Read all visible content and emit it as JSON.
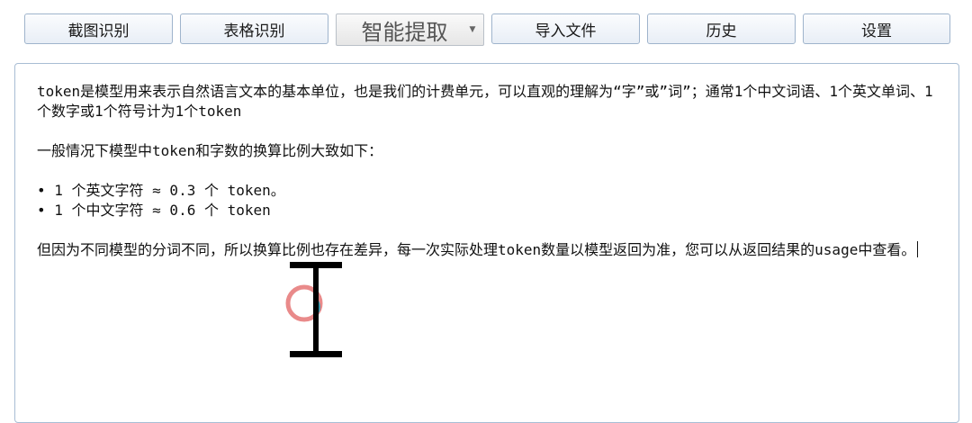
{
  "toolbar": {
    "screenshot_ocr": "截图识别",
    "table_ocr": "表格识别",
    "smart_extract": "智能提取",
    "import_file": "导入文件",
    "history": "历史",
    "settings": "设置"
  },
  "editor": {
    "para1": "token是模型用来表示自然语言文本的基本单位，也是我们的计费单元，可以直观的理解为“字”或”词”；通常1个中文词语、1个英文单词、1个数字或1个符号计为1个token",
    "para2": "一般情况下模型中token和字数的换算比例大致如下：",
    "bullets": [
      "• 1 个英文字符 ≈ 0.3 个 token。",
      "• 1 个中文字符 ≈ 0.6 个 token"
    ],
    "para3": "但因为不同模型的分词不同，所以换算比例也存在差异，每一次实际处理token数量以模型返回为准，您可以从返回结果的usage中查看。"
  },
  "icons": {
    "dropdown_arrow": "chevron-down-icon",
    "cursor": "text-cursor-icon",
    "click_indicator": "click-ring-icon"
  },
  "colors": {
    "button_border": "#9fb4cc",
    "editor_border": "#a8bdd4",
    "click_ring": "#e98a8a"
  }
}
